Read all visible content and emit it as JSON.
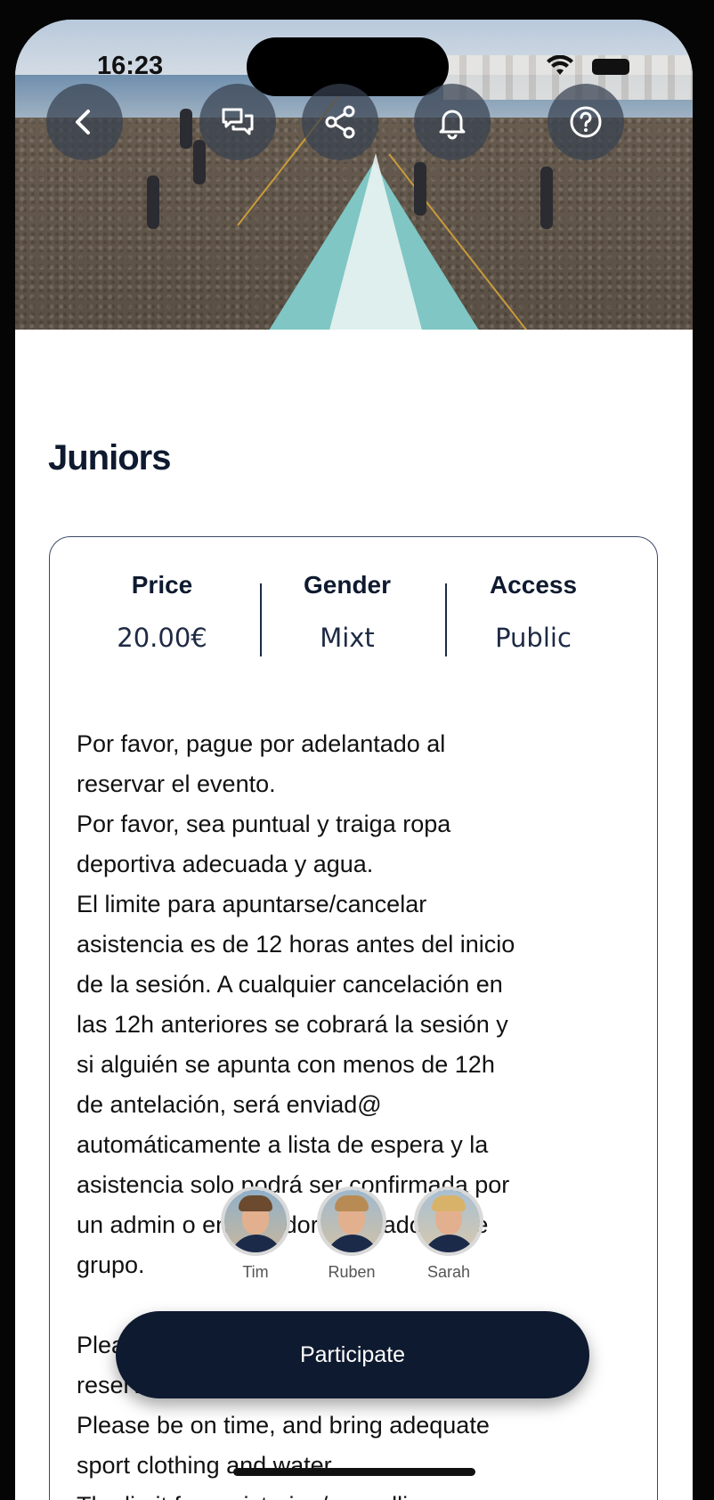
{
  "status_bar": {
    "time": "16:23"
  },
  "hero": {
    "buttons": [
      {
        "name": "back-button",
        "icon": "chevron-left-icon"
      },
      {
        "name": "chat-button",
        "icon": "chat-bubbles-icon"
      },
      {
        "name": "share-button",
        "icon": "share-icon"
      },
      {
        "name": "notifications-button",
        "icon": "bell-icon"
      },
      {
        "name": "help-button",
        "icon": "question-circle-icon"
      }
    ]
  },
  "event": {
    "title": "Juniors",
    "stats": [
      {
        "label": "Price",
        "value": "20.00€"
      },
      {
        "label": "Gender",
        "value": "Mixt"
      },
      {
        "label": "Access",
        "value": "Public"
      }
    ],
    "description": "Por favor, pague por adelantado al\nreservar el evento.\nPor favor, sea puntual y traiga ropa\ndeportiva adecuada y agua.\nEl limite para apuntarse/cancelar\nasistencia es de 12 horas antes del inicio\nde la sesión. A cualquier cancelación en\nlas 12h anteriores se cobrará la sesión y\nsi alguién se apunta con menos de 12h\nde antelación, será enviad@\nautomáticamente a lista de espera y la\nasistencia solo podrá ser confirmada por\nun admin o entrenador asignado a ese\ngrupo.\n\nPlease pay in advance when\nreserving the event.\nPlease be on time, and bring adequate\nsport clothing and water.\nThe limit for registering/cancelling a"
  },
  "participants": [
    {
      "name": "Tim"
    },
    {
      "name": "Ruben"
    },
    {
      "name": "Sarah"
    }
  ],
  "cta": {
    "label": "Participate"
  },
  "colors": {
    "primary": "#0e1a2f",
    "hero_button": "#374150"
  }
}
